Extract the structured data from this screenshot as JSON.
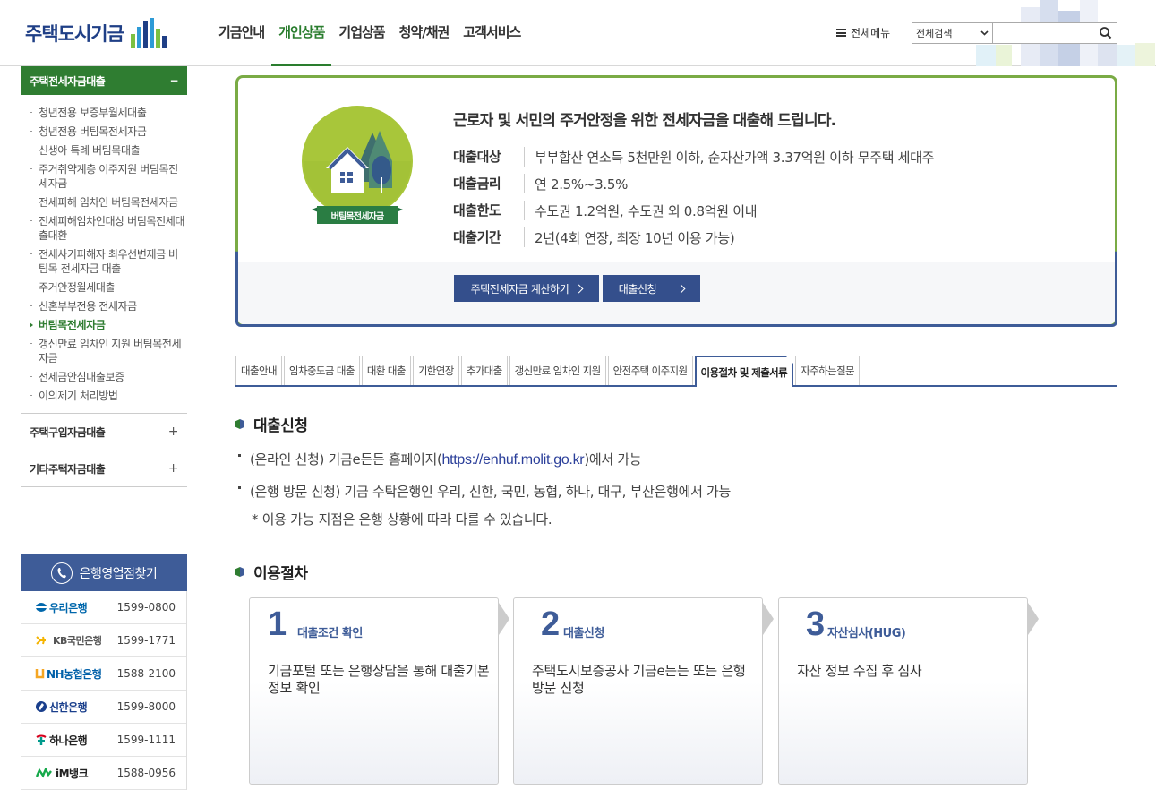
{
  "header": {
    "logo_text": "주택도시기금",
    "gnb": [
      "기금안내",
      "개인상품",
      "기업상품",
      "청약/채권",
      "고객서비스"
    ],
    "gnb_active": 1,
    "menu_all": "전체메뉴",
    "search_select": "전체검색",
    "search_value": ""
  },
  "sidebar": {
    "active_section": "주택전세자금대출",
    "active_toggle": "−",
    "sub_items": [
      "청년전용 보증부월세대출",
      "청년전용 버팀목전세자금",
      "신생아 특례 버팀목대출",
      "주거취약계층 이주지원 버팀목전세자금",
      "전세피해 임차인 버팀목전세자금",
      "전세피해임차인대상 버팀목전세대출대환",
      "전세사기피해자 최우선변제금 버팀목 전세자금 대출",
      "주거안정월세대출",
      "신혼부부전용 전세자금",
      "버팀목전세자금",
      "갱신만료 임차인 지원 버팀목전세자금",
      "전세금안심대출보증",
      "이의제기 처리방법"
    ],
    "sub_active": 9,
    "sections": [
      {
        "label": "주택구입자금대출",
        "toggle": "+"
      },
      {
        "label": "기타주택자금대출",
        "toggle": "+"
      }
    ],
    "bank_title": "은행영업점찾기",
    "banks": [
      {
        "name": "우리은행",
        "tel": "1599-0800",
        "color": "#0067ac"
      },
      {
        "name": "KB국민은행",
        "tel": "1599-1771",
        "color": "#555555"
      },
      {
        "name": "NH농협은행",
        "tel": "1588-2100",
        "color": "#0060a9"
      },
      {
        "name": "신한은행",
        "tel": "1599-8000",
        "color": "#1a3f8c"
      },
      {
        "name": "하나은행",
        "tel": "1599-1111",
        "color": "#222222"
      },
      {
        "name": "iM뱅크",
        "tel": "1588-0956",
        "color": "#222222"
      }
    ]
  },
  "product": {
    "badge_label": "버팀목전세자금",
    "title": "근로자 및 서민의 주거안정을 위한 전세자금을 대출해 드립니다.",
    "info": [
      {
        "key": "대출대상",
        "value": "부부합산 연소득 5천만원 이하, 순자산가액 3.37억원 이하 무주택 세대주"
      },
      {
        "key": "대출금리",
        "value": "연 2.5%~3.5%"
      },
      {
        "key": "대출한도",
        "value": "수도권 1.2억원, 수도권 외 0.8억원 이내"
      },
      {
        "key": "대출기간",
        "value": "2년(4회 연장, 최장 10년 이용 가능)"
      }
    ],
    "btn_calc": "주택전세자금 계산하기",
    "btn_apply": "대출신청"
  },
  "tabs": [
    "대출안내",
    "임차중도금 대출",
    "대환 대출",
    "기한연장",
    "추가대출",
    "갱신만료 임차인 지원",
    "안전주택 이주지원",
    "이용절차 및 제출서류",
    "자주하는질문"
  ],
  "tab_active": 7,
  "apply": {
    "title": "대출신청",
    "line1_pre": "(온라인 신청) 기금e든든 홈페이지(",
    "line1_link": "https://enhuf.molit.go.kr",
    "line1_post": ")에서 가능",
    "line2": "(은행 방문 신청) 기금 수탁은행인 우리, 신한, 국민, 농협, 하나, 대구, 부산은행에서 가능",
    "note": "* 이용 가능 지점은 은행 상황에 따라 다를 수 있습니다."
  },
  "procedure": {
    "title": "이용절차",
    "steps": [
      {
        "num": "1",
        "title": "대출조건 확인",
        "desc": "기금포털 또는 은행상담을 통해 대출기본정보 확인"
      },
      {
        "num": "2",
        "title": "대출신청",
        "desc": "주택도시보증공사 기금e든든 또는 은행 방문 신청"
      },
      {
        "num": "3",
        "title": "자산심사(HUG)",
        "desc": "자산 정보 수집 후 심사"
      }
    ]
  },
  "colors": {
    "green": "#2f7d31",
    "navy": "#3e5c98",
    "button": "#344f8c",
    "lime": "#a8c63a"
  }
}
